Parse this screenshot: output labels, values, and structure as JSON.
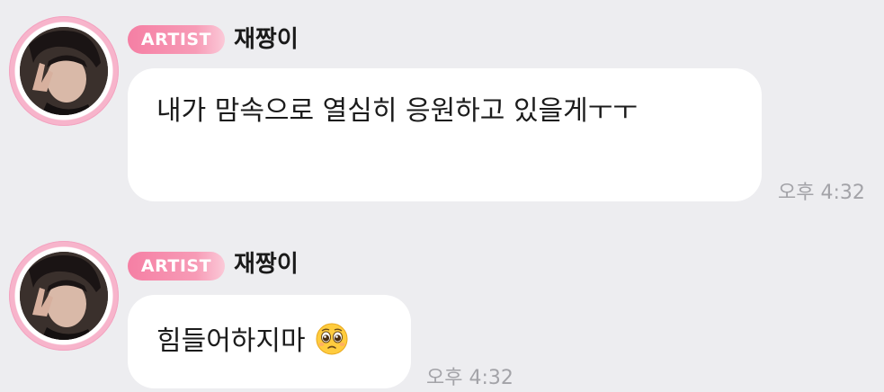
{
  "messages": [
    {
      "badge": "ARTIST",
      "sender": "재짱이",
      "text": "내가 맘속으로 열심히 응원하고 있을게ㅜㅜ",
      "time": "오후 4:32"
    },
    {
      "badge": "ARTIST",
      "sender": "재짱이",
      "text": "힘들어하지마",
      "emoji": "pleading-face",
      "time": "오후 4:32"
    }
  ],
  "colors": {
    "background": "#ededf0",
    "badge": "#f57fa4",
    "avatar_ring": "#f7b4cb",
    "bubble": "#ffffff",
    "time": "#a3a3a8"
  }
}
